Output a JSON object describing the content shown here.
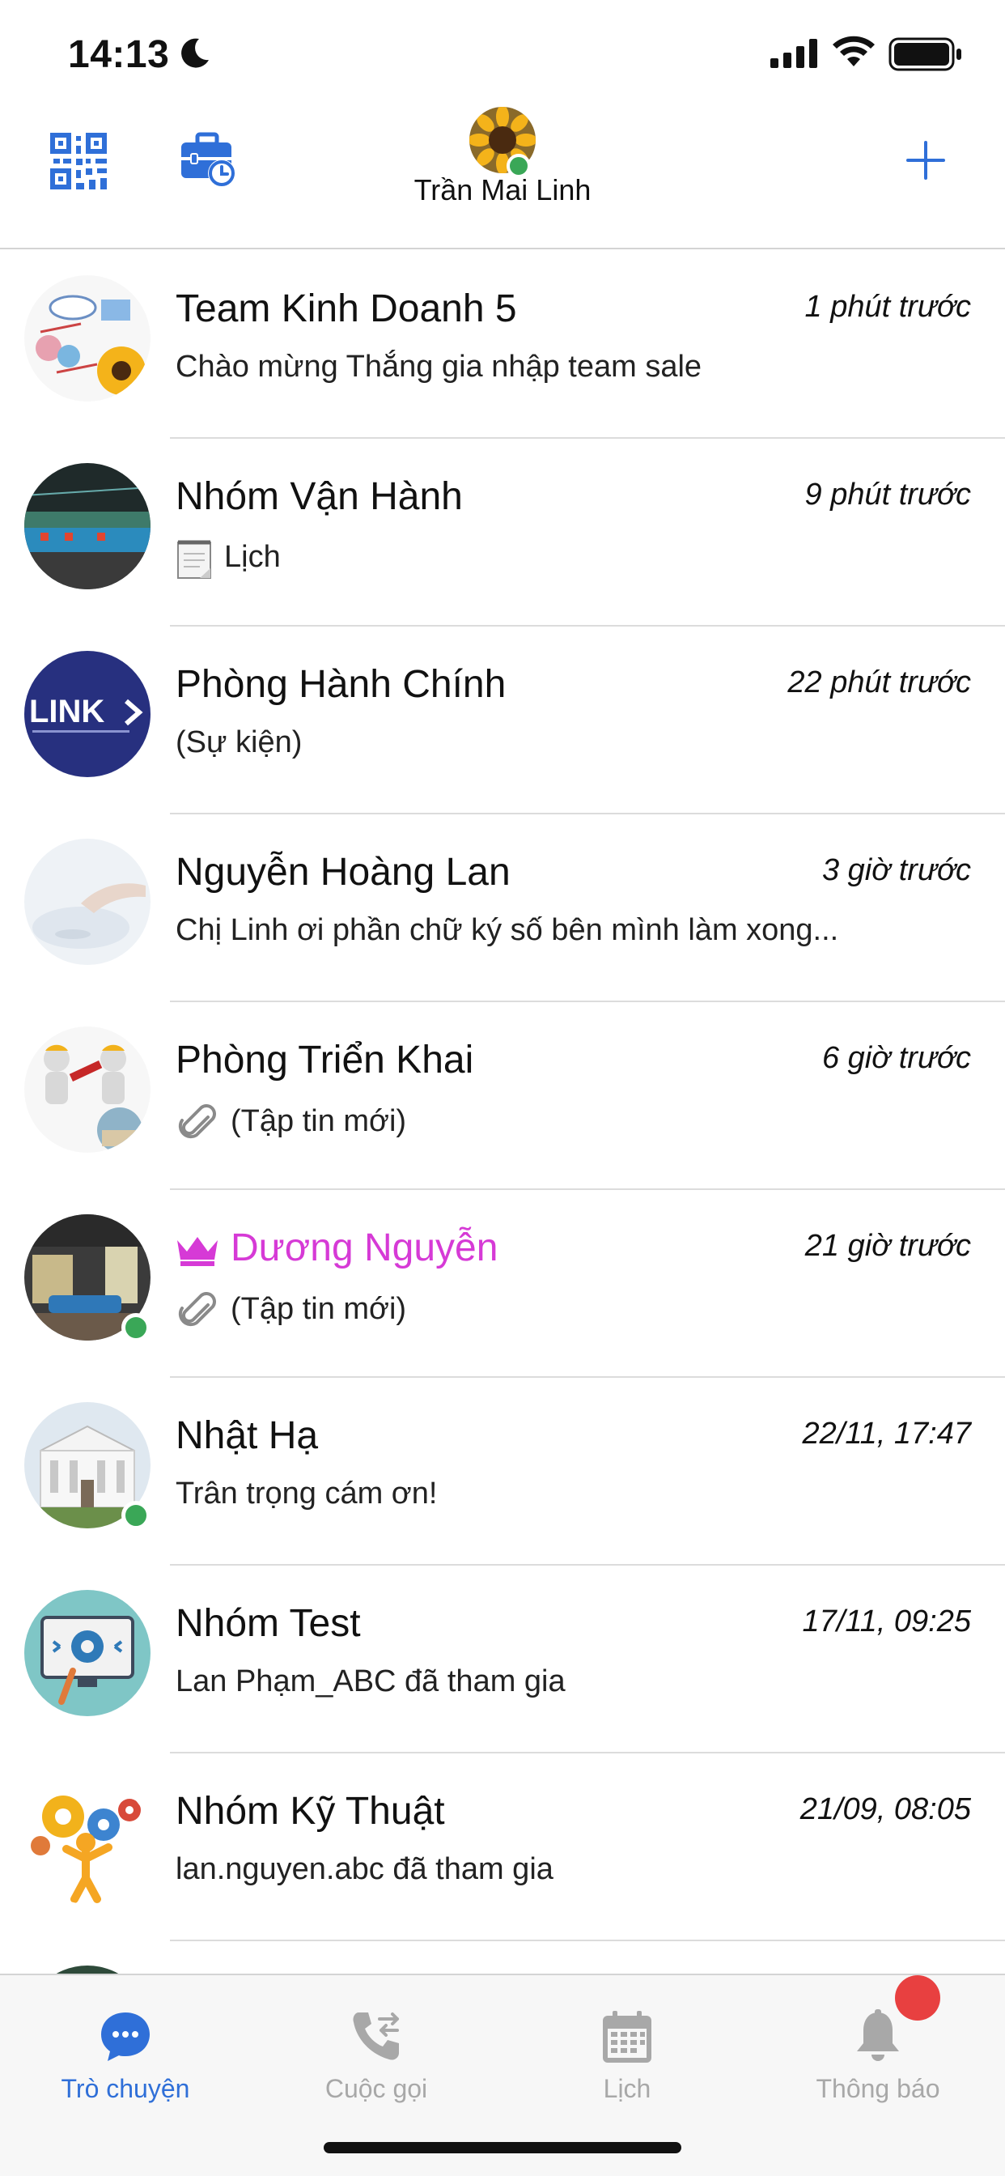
{
  "status_bar": {
    "time": "14:13"
  },
  "header": {
    "user_name": "Trần Mai Linh"
  },
  "chats": [
    {
      "name": "Team Kinh Doanh 5",
      "time": "1 phút trước",
      "preview": "Chào mừng Thắng gia nhập team sale"
    },
    {
      "name": "Nhóm Vận Hành",
      "time": "9 phút trước",
      "preview": "Lịch",
      "preview_icon": "notepad-icon"
    },
    {
      "name": "Phòng Hành Chính",
      "time": "22 phút trước",
      "preview": "(Sự kiện)",
      "avatar_text": "LINK"
    },
    {
      "name": "Nguyễn Hoàng Lan",
      "time": "3 giờ trước",
      "preview": "Chị Linh ơi phần chữ ký số bên mình làm xong..."
    },
    {
      "name": "Phòng Triển Khai",
      "time": "6 giờ trước",
      "preview": "(Tập tin mới)",
      "preview_icon": "paperclip-icon"
    },
    {
      "name": "Dương Nguyễn",
      "time": "21 giờ trước",
      "preview": "(Tập tin mới)",
      "preview_icon": "paperclip-icon",
      "name_color": "#d63ad6",
      "name_icon": "crown-icon",
      "online": true
    },
    {
      "name": "Nhật Hạ",
      "time": "22/11, 17:47",
      "preview": "Trân trọng cám ơn!",
      "online": true
    },
    {
      "name": "Nhóm Test",
      "time": "17/11, 09:25",
      "preview": "Lan Phạm_ABC đã tham gia"
    },
    {
      "name": "Nhóm Kỹ Thuật",
      "time": "21/09, 08:05",
      "preview": "lan.nguyen.abc đã tham gia"
    }
  ],
  "tabs": [
    {
      "label": "Trò chuyện",
      "icon": "chat-bubble-icon",
      "active": true
    },
    {
      "label": "Cuộc gọi",
      "icon": "phone-call-icon",
      "active": false
    },
    {
      "label": "Lịch",
      "icon": "calendar-icon",
      "active": false
    },
    {
      "label": "Thông báo",
      "icon": "bell-icon",
      "active": false
    }
  ],
  "colors": {
    "accent": "#2f6fd8",
    "online": "#3aa757",
    "badge": "#e84040",
    "vip_name": "#d63ad6"
  }
}
